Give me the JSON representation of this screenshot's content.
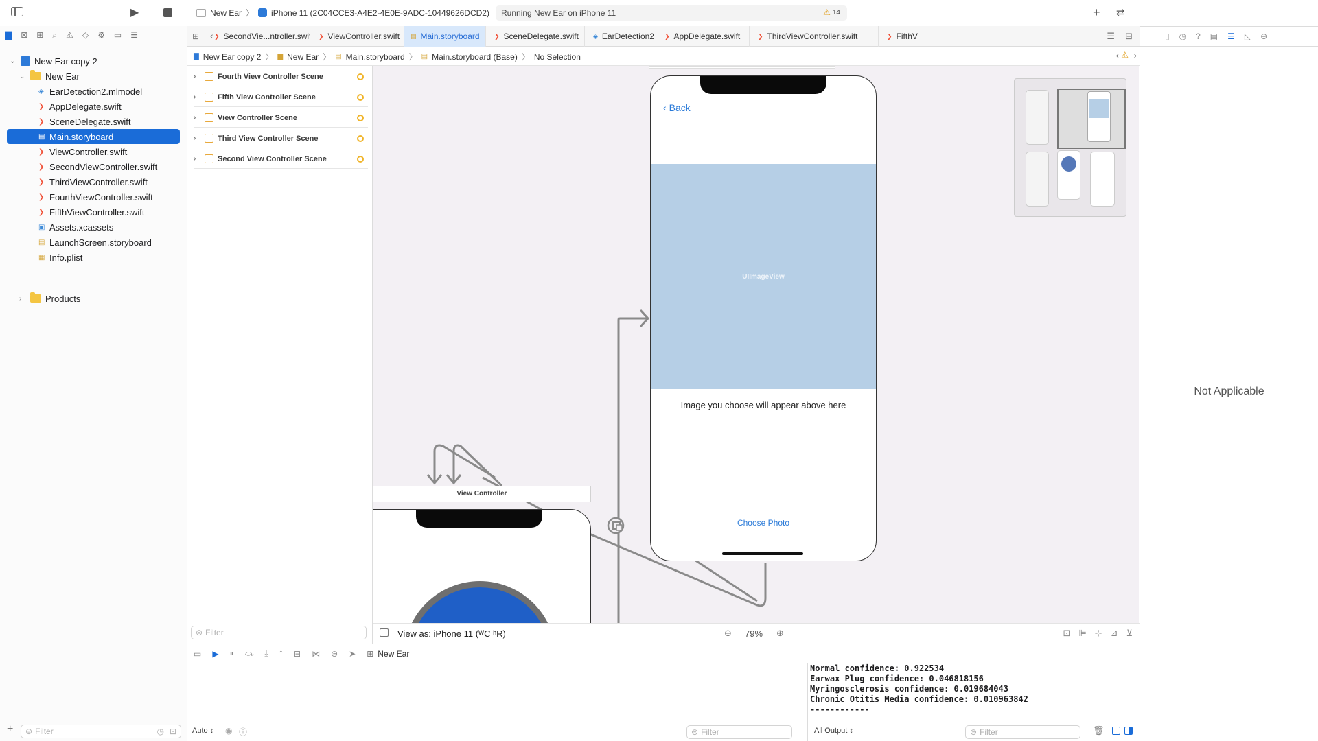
{
  "toolbar": {
    "scheme_project": "New Ear",
    "scheme_device": "iPhone 11 (2C04CCE3-A4E2-4E0E-9ADC-10449626DCD2)",
    "status_text": "Running New Ear on iPhone 11",
    "warning_count": "14"
  },
  "tabs": [
    {
      "label": "SecondVie...ntroller.swift",
      "icon": "swift-icon",
      "active": false
    },
    {
      "label": "ViewController.swift",
      "icon": "swift-icon",
      "active": false
    },
    {
      "label": "Main.storyboard",
      "icon": "storyboard-icon",
      "active": true
    },
    {
      "label": "SceneDelegate.swift",
      "icon": "swift-icon",
      "active": false
    },
    {
      "label": "EarDetection2",
      "icon": "mlmodel-icon",
      "active": false
    },
    {
      "label": "AppDelegate.swift",
      "icon": "swift-icon",
      "active": false
    },
    {
      "label": "ThirdViewController.swift",
      "icon": "swift-icon",
      "active": false
    },
    {
      "label": "FifthV",
      "icon": "swift-icon",
      "active": false
    }
  ],
  "jumpbar": {
    "items": [
      "New Ear copy 2",
      "New Ear",
      "Main.storyboard",
      "Main.storyboard (Base)",
      "No Selection"
    ]
  },
  "navigator": {
    "project": "New Ear copy 2",
    "group": "New Ear",
    "files": [
      {
        "name": "EarDetection2.mlmodel",
        "icon": "mlmodel-icon"
      },
      {
        "name": "AppDelegate.swift",
        "icon": "swift-icon"
      },
      {
        "name": "SceneDelegate.swift",
        "icon": "swift-icon"
      },
      {
        "name": "Main.storyboard",
        "icon": "storyboard-icon",
        "selected": true
      },
      {
        "name": "ViewController.swift",
        "icon": "swift-icon"
      },
      {
        "name": "SecondViewController.swift",
        "icon": "swift-icon"
      },
      {
        "name": "ThirdViewController.swift",
        "icon": "swift-icon"
      },
      {
        "name": "FourthViewController.swift",
        "icon": "swift-icon"
      },
      {
        "name": "FifthViewController.swift",
        "icon": "swift-icon"
      },
      {
        "name": "Assets.xcassets",
        "icon": "assets-icon"
      },
      {
        "name": "LaunchScreen.storyboard",
        "icon": "storyboard-icon"
      },
      {
        "name": "Info.plist",
        "icon": "plist-icon"
      }
    ],
    "products": "Products",
    "filter_placeholder": "Filter"
  },
  "outline": {
    "scenes": [
      "Fourth View Controller Scene",
      "Fifth View Controller Scene",
      "View Controller Scene",
      "Third View Controller Scene",
      "Second View Controller Scene"
    ],
    "filter_placeholder": "Filter"
  },
  "canvas": {
    "back_label": "Back",
    "image_view_label": "UIImageView",
    "caption": "Image you choose will appear above here",
    "choose_photo": "Choose Photo",
    "view_controller_title": "View Controller"
  },
  "canvas_bar": {
    "view_as": "View as: iPhone 11 (ᵂC ʰR)",
    "zoom": "79%"
  },
  "inspector": {
    "placeholder": "Not Applicable"
  },
  "debug": {
    "target": "New Ear",
    "console_lines": [
      "Normal confidence: 0.922534",
      "Earwax Plug confidence: 0.046818156",
      "Myringosclerosis confidence: 0.019684043",
      "Chronic Otitis Media confidence: 0.010963842",
      "------------"
    ],
    "auto_label": "Auto ↕",
    "output_label": "All Output ↕",
    "filter_placeholder": "Filter"
  },
  "colors": {
    "accent": "#1a6cd8",
    "link": "#2a7ad8",
    "image_view": "#b6cfe6",
    "warning": "#f0b429"
  }
}
